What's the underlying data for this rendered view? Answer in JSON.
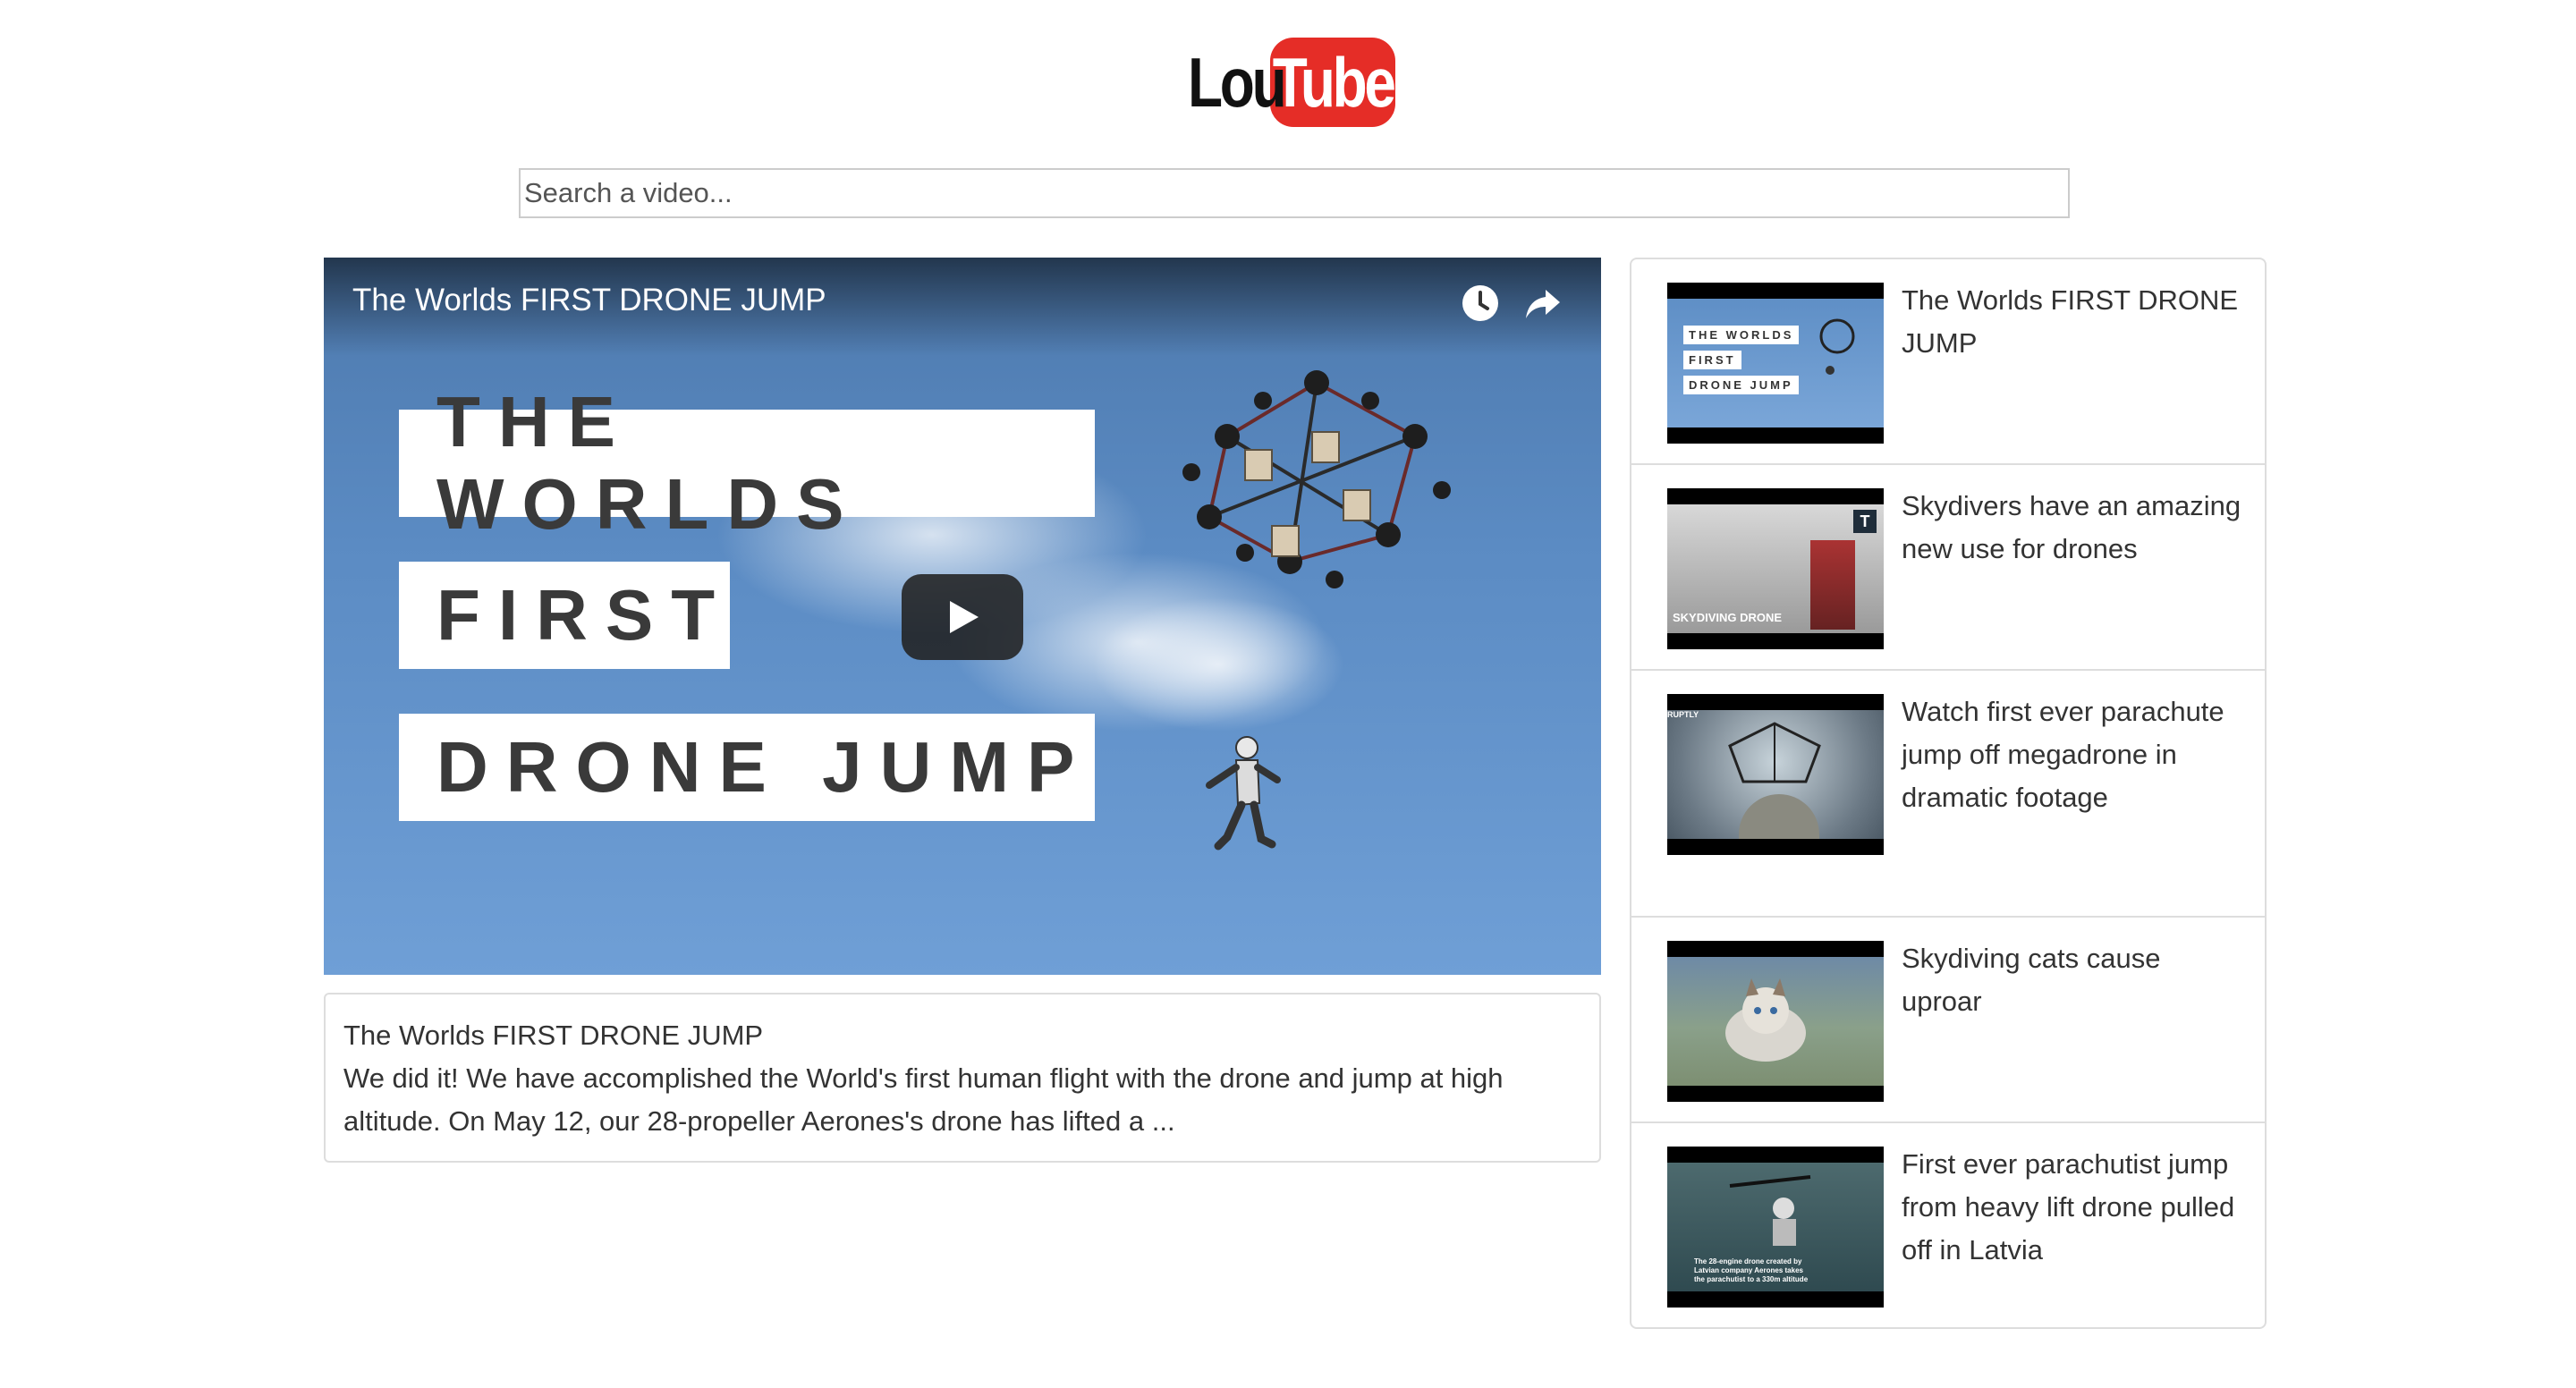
{
  "logo": {
    "part1": "Lou",
    "part2": "Tube"
  },
  "search": {
    "placeholder": "Search a video...",
    "value": ""
  },
  "player": {
    "title": "The Worlds FIRST DRONE JUMP",
    "thumbnail_lines": [
      "THE WORLDS",
      "FIRST",
      "DRONE JUMP"
    ],
    "icons": [
      "watch-later-icon",
      "share-icon",
      "play-icon"
    ]
  },
  "selected_video": {
    "title": "The Worlds FIRST DRONE JUMP",
    "description": "We did it! We have accomplished the World's first human flight with the drone and jump at high altitude. On May 12, our 28-propeller Aerones's drone has lifted a ..."
  },
  "related": [
    {
      "title": "The Worlds FIRST DRONE JUMP",
      "thumb_overlay": [
        "THE WORLDS",
        "FIRST",
        "DRONE JUMP"
      ]
    },
    {
      "title": "Skydivers have an amazing new use for drones",
      "thumb_overlay": [
        "SKYDIVING DRONE",
        "T"
      ]
    },
    {
      "title": "Watch first ever parachute jump off megadrone in dramatic footage",
      "thumb_overlay": [
        "RUPTLY"
      ]
    },
    {
      "title": "Skydiving cats cause uproar",
      "thumb_overlay": []
    },
    {
      "title": "First ever parachutist jump from heavy lift drone pulled off in Latvia",
      "thumb_overlay": [
        "The 28-engine drone created by",
        "Latvian company Aerones takes",
        "the parachutist to a 330m altitude"
      ]
    }
  ],
  "colors": {
    "brand_red": "#e52d27",
    "border": "#dddddd",
    "text": "#333333"
  }
}
